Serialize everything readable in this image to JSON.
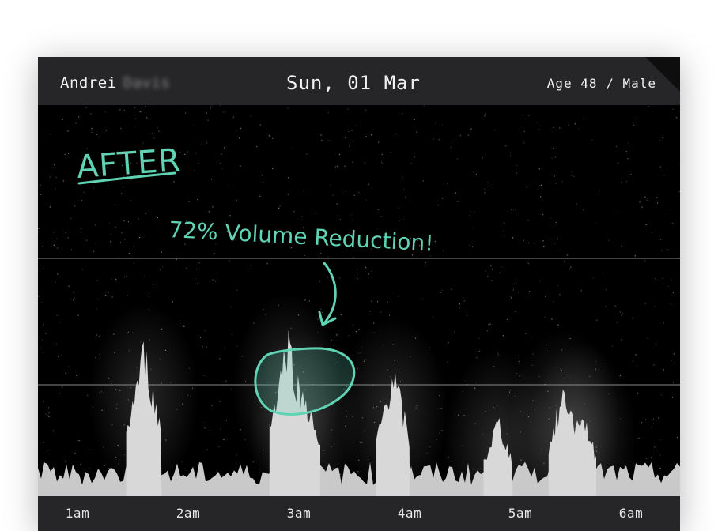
{
  "header": {
    "name": "Andrei",
    "surname_redacted": "Davis",
    "date": "Sun, 01 Mar",
    "age_sex": "Age 48 / Male"
  },
  "annotations": {
    "after_label": "AFTER",
    "reduction_note": "72% Volume Reduction!"
  },
  "colors": {
    "accent": "#5fd3b4",
    "header_bg": "#262628",
    "chart_bg": "#000000",
    "signal": "#d8d8d8"
  },
  "chart_data": {
    "type": "area",
    "title": "",
    "xlabel": "",
    "ylabel": "",
    "x_ticks": [
      "1am",
      "2am",
      "3am",
      "4am",
      "5am",
      "6am"
    ],
    "x_range_hours": [
      0.6,
      6.4
    ],
    "reference_lines": 2,
    "spikes": [
      {
        "hour": 1.6,
        "peak": 0.42
      },
      {
        "hour": 2.9,
        "peak": 0.46
      },
      {
        "hour": 3.05,
        "peak": 0.3
      },
      {
        "hour": 3.85,
        "peak": 0.36
      },
      {
        "hour": 4.8,
        "peak": 0.22
      },
      {
        "hour": 5.4,
        "peak": 0.31
      },
      {
        "hour": 5.55,
        "peak": 0.25
      }
    ],
    "baseline_level": 0.08
  },
  "icons": [
    "annotation-arrow-icon",
    "highlight-circle-icon"
  ]
}
